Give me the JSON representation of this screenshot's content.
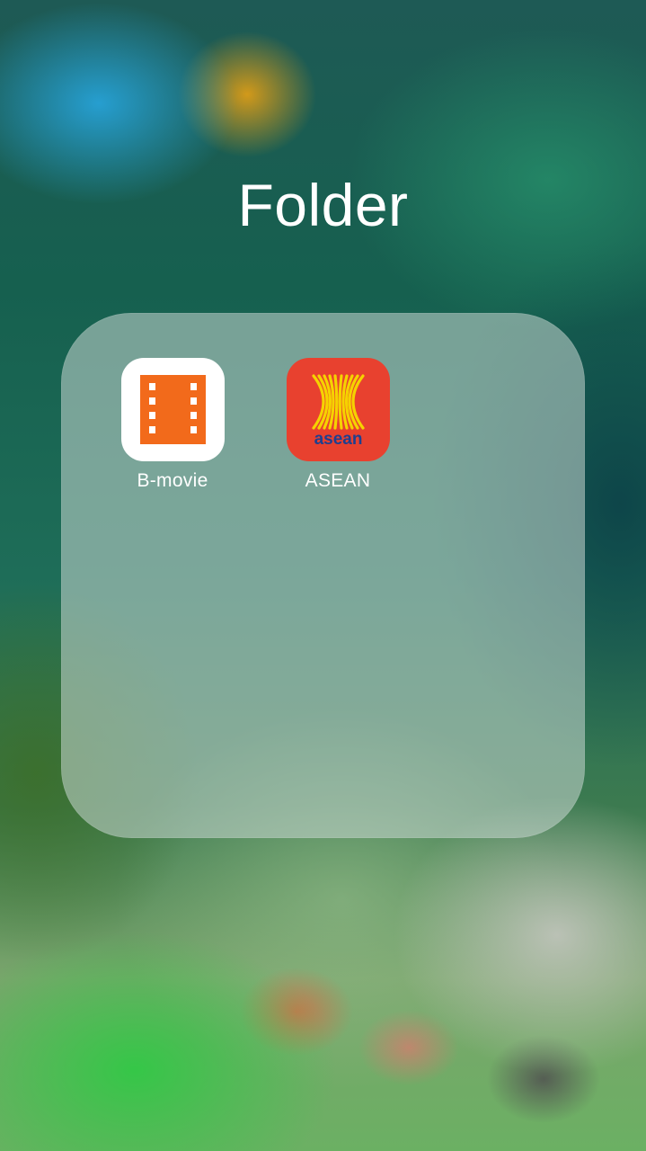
{
  "folder": {
    "title": "Folder"
  },
  "apps": [
    {
      "label": "B-movie",
      "icon": "film-strip-icon",
      "icon_color": "#f26a1b",
      "background": "#ffffff"
    },
    {
      "label": "ASEAN",
      "icon": "asean-logo-icon",
      "icon_text": "asean",
      "background": "#e8412f",
      "accent": "#f5d200",
      "text_color": "#1f3f8f"
    }
  ]
}
